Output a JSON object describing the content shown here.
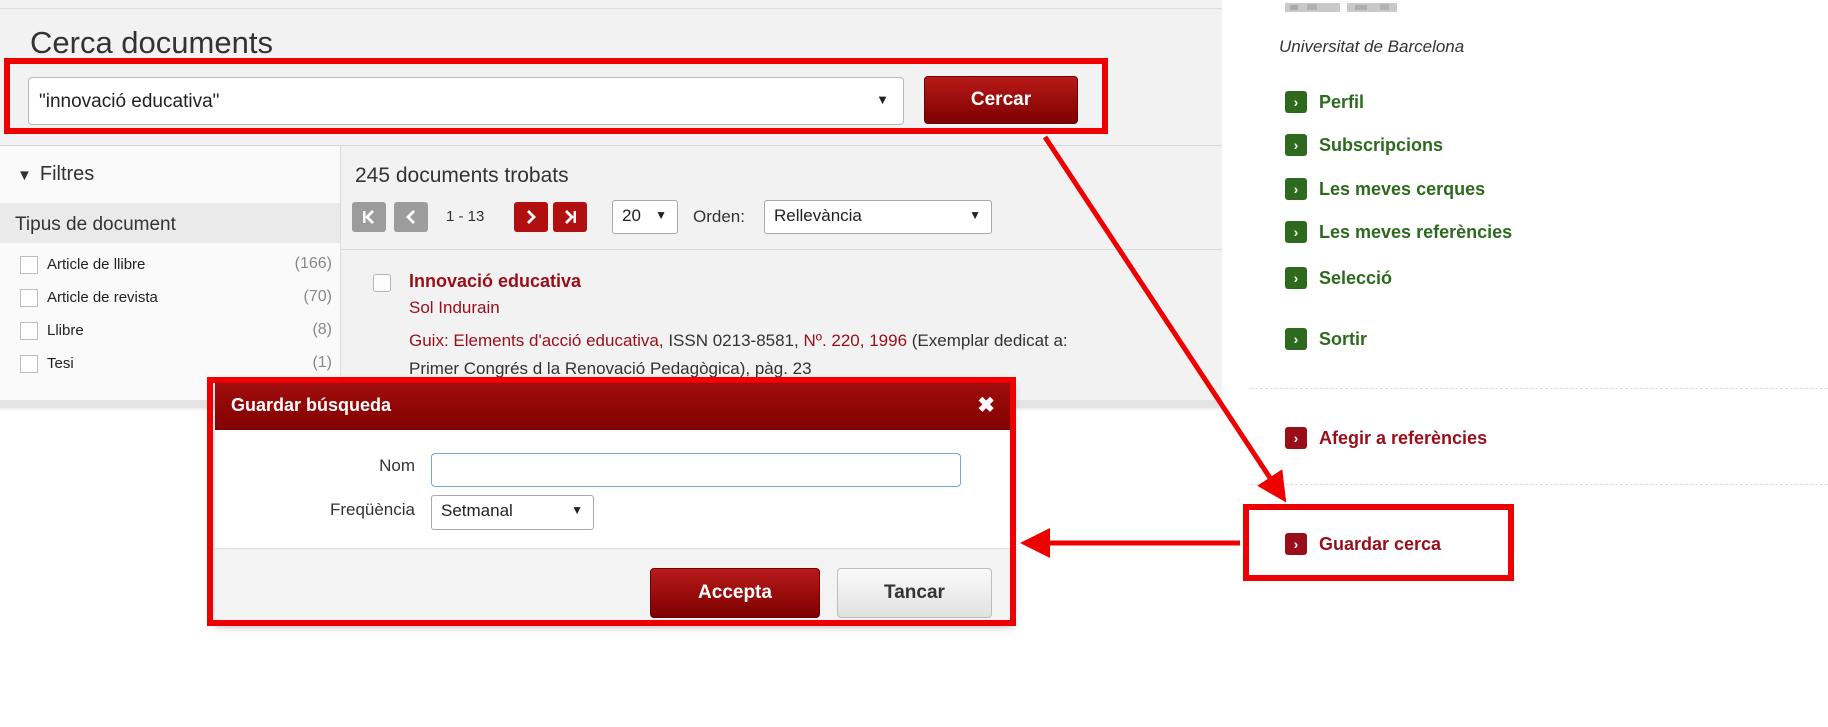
{
  "page": {
    "title": "Cerca documents"
  },
  "search": {
    "value": "\"innovació educativa\"",
    "button_label": "Cercar"
  },
  "filters": {
    "title": "Filtres",
    "section_title": "Tipus de document",
    "items": [
      {
        "label": "Article de llibre",
        "count": "(166)"
      },
      {
        "label": "Article de revista",
        "count": "(70)"
      },
      {
        "label": "Llibre",
        "count": "(8)"
      },
      {
        "label": "Tesi",
        "count": "(1)"
      }
    ]
  },
  "results": {
    "count_text": "245 documents trobats",
    "range_text": "1 - 13",
    "per_page": "20",
    "sort_label": "Orden:",
    "sort_value": "Rellevància",
    "items": [
      {
        "title": "Innovació educativa",
        "author": "Sol Indurain",
        "source": "Guix: Elements d'acció educativa,",
        "issn": " ISSN 0213-8581, ",
        "issue": "Nº. 220, 1996",
        "extra": " (Exemplar dedicat a:",
        "extra_line2": "Primer Congrés d la Renovació Pedagògica), pàg. 23"
      }
    ]
  },
  "sidebar": {
    "university": "Universitat de Barcelona",
    "items": [
      {
        "label": "Perfil"
      },
      {
        "label": "Subscripcions"
      },
      {
        "label": "Les meves cerques"
      },
      {
        "label": "Les meves referències"
      },
      {
        "label": "Selecció"
      },
      {
        "label": "Sortir"
      }
    ],
    "actions": [
      {
        "label": "Afegir a referències"
      },
      {
        "label": "Guardar cerca"
      }
    ]
  },
  "dialog": {
    "title": "Guardar búsqueda",
    "close_symbol": "✖",
    "nom_label": "Nom",
    "nom_value": "",
    "freq_label": "Freqüència",
    "freq_value": "Setmanal",
    "accept_label": "Accepta",
    "cancel_label": "Tancar"
  },
  "colors": {
    "brand_red": "#9a0e1a",
    "nav_green": "#2d6a1e",
    "annotation_red": "#ee0000"
  },
  "icons": {
    "filter": "filter-icon",
    "first_page": "first-page-icon",
    "prev_page": "prev-page-icon",
    "next_page": "next-page-icon",
    "last_page": "last-page-icon",
    "nav_arrow": "chevron-right-icon",
    "close": "close-icon"
  }
}
